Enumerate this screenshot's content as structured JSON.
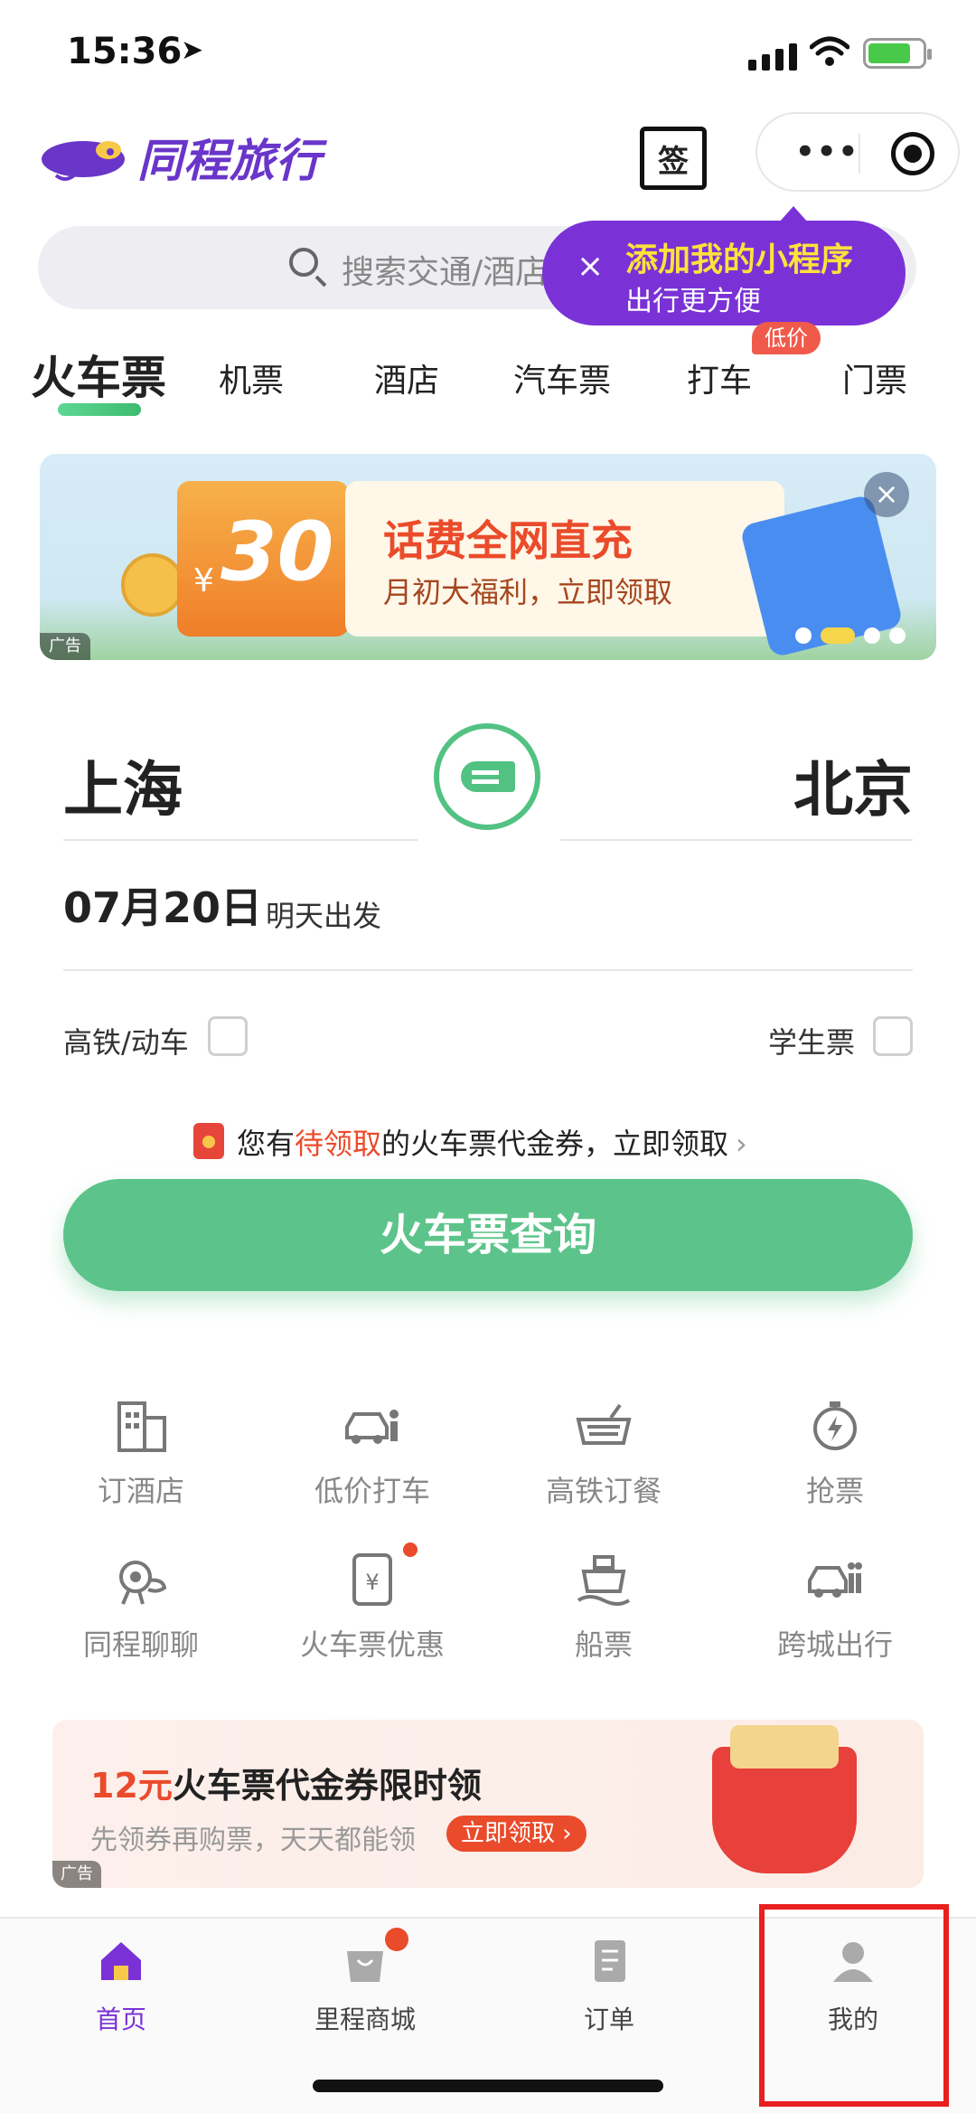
{
  "status_bar": {
    "time": "15:36"
  },
  "header": {
    "brand": "同程旅行",
    "sign_label": "签",
    "capsule_more": "•••"
  },
  "search": {
    "placeholder": "搜索交通/酒店"
  },
  "popup": {
    "title": "添加我的小程序",
    "subtitle": "出行更方便",
    "close": "×"
  },
  "tabs": [
    {
      "label": "火车票"
    },
    {
      "label": "机票"
    },
    {
      "label": "酒店"
    },
    {
      "label": "汽车票"
    },
    {
      "label": "打车"
    },
    {
      "label": "门票"
    }
  ],
  "tab_badge": "低价",
  "banner": {
    "amount": "30",
    "currency": "¥",
    "title": "话费全网直充",
    "subtitle": "月初大福利，立即领取",
    "ad_tag": "广告",
    "close": "×"
  },
  "trip": {
    "from": "上海",
    "to": "北京",
    "date": "07月20日",
    "date_note": "明天出发",
    "option_highspeed": "高铁/动车",
    "option_student": "学生票"
  },
  "coupon_notice": {
    "prefix": "您有",
    "highlight": "待领取",
    "suffix": "的火车票代金券，立即领取",
    "arrow": "›"
  },
  "query_button": "火车票查询",
  "services": [
    {
      "label": "订酒店",
      "icon": "hotel-building-icon"
    },
    {
      "label": "低价打车",
      "icon": "taxi-car-icon"
    },
    {
      "label": "高铁订餐",
      "icon": "meal-basket-icon"
    },
    {
      "label": "抢票",
      "icon": "stopwatch-lightning-icon"
    },
    {
      "label": "同程聊聊",
      "icon": "chat-mascot-icon"
    },
    {
      "label": "火车票优惠",
      "icon": "coupon-yen-icon"
    },
    {
      "label": "船票",
      "icon": "ship-icon"
    },
    {
      "label": "跨城出行",
      "icon": "intercity-car-icon"
    }
  ],
  "promo": {
    "amount": "12元",
    "title": "火车票代金券限时领",
    "subtitle": "先领券再购票，天天都能领",
    "button": "立即领取 ›",
    "ad_tag": "广告"
  },
  "tabbar": [
    {
      "label": "首页",
      "icon": "home-icon"
    },
    {
      "label": "里程商城",
      "icon": "shopping-bag-icon"
    },
    {
      "label": "订单",
      "icon": "order-document-icon"
    },
    {
      "label": "我的",
      "icon": "profile-person-icon"
    }
  ],
  "colors": {
    "brand_purple": "#7a32d6",
    "train_green": "#5cc48a",
    "accent_red": "#ea4b2b",
    "highlight_box": "#e8201f"
  }
}
